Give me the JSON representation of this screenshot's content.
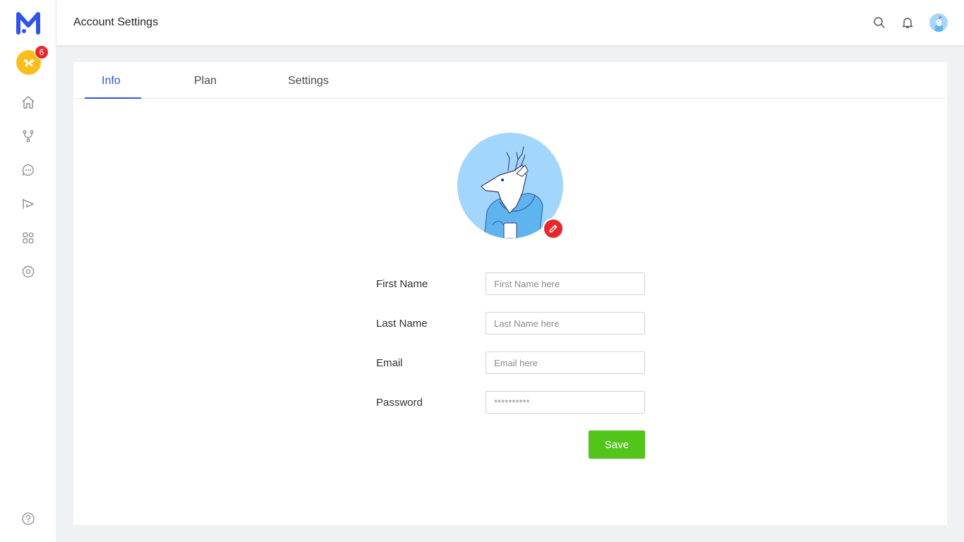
{
  "header": {
    "title": "Account Settings",
    "icons": [
      "search-icon",
      "bell-icon",
      "avatar"
    ]
  },
  "sidebar": {
    "workspace_badge": "6",
    "nav_icons": [
      "home-icon",
      "branch-icon",
      "chat-icon",
      "campaign-icon",
      "apps-icon",
      "settings-icon",
      "help-icon"
    ],
    "brand_color": "#2f54eb",
    "workspace_color": "#fbbf1b"
  },
  "tabs": [
    {
      "label": "Info",
      "active": true
    },
    {
      "label": "Plan",
      "active": false
    },
    {
      "label": "Settings",
      "active": false
    }
  ],
  "form": {
    "first_name": {
      "label": "First Name",
      "placeholder": "First Name here",
      "value": ""
    },
    "last_name": {
      "label": "Last Name",
      "placeholder": "Last Name here",
      "value": ""
    },
    "email": {
      "label": "Email",
      "placeholder": "Email here",
      "value": ""
    },
    "password": {
      "label": "Password",
      "placeholder": "**********",
      "value": ""
    },
    "save_label": "Save",
    "save_color": "#52c41a"
  }
}
